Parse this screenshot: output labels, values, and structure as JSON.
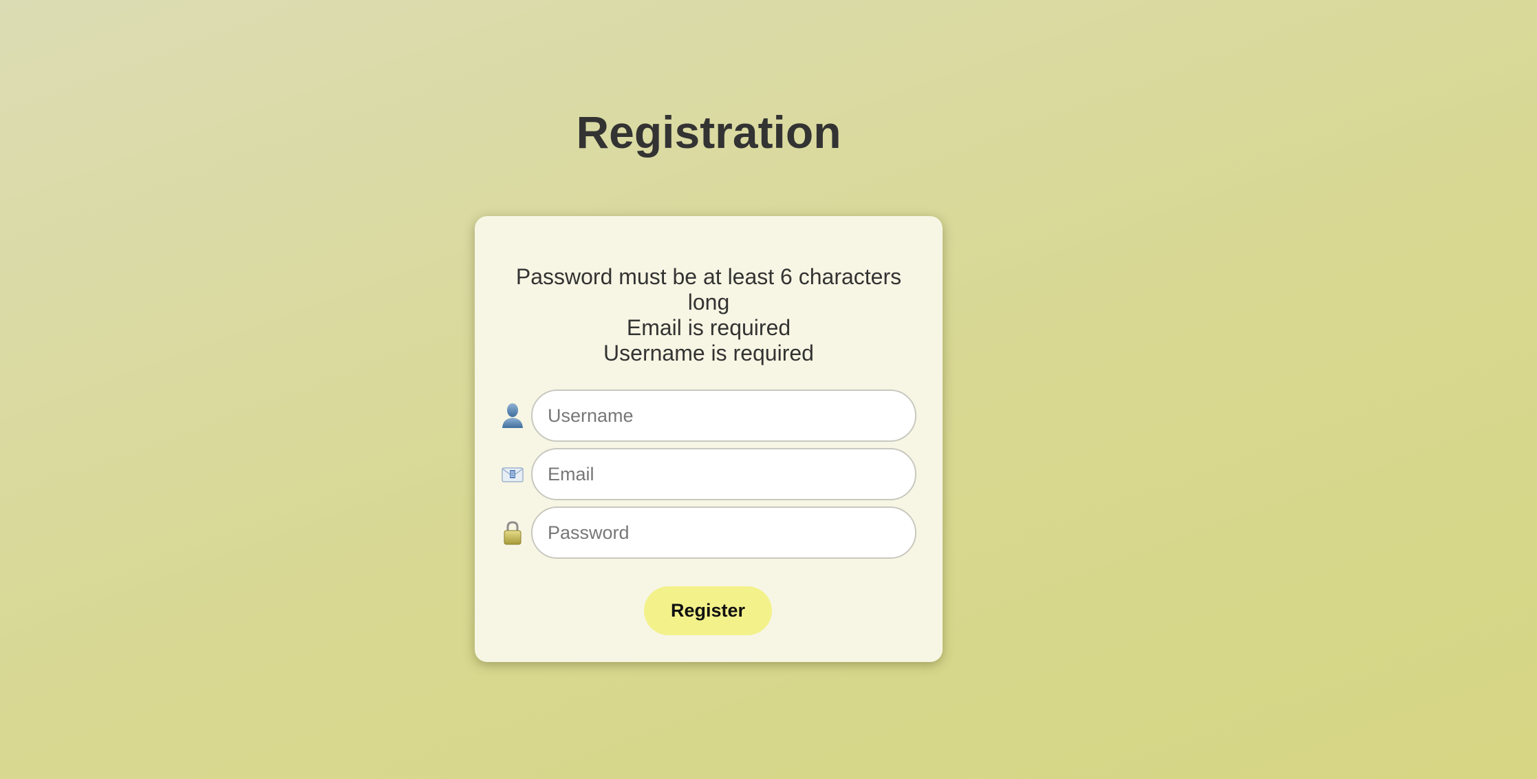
{
  "page": {
    "title": "Registration"
  },
  "errors": [
    "Password must be at least 6 characters long",
    "Email is required",
    "Username is required"
  ],
  "form": {
    "username": {
      "value": "",
      "placeholder": "Username",
      "icon": "user-icon"
    },
    "email": {
      "value": "",
      "placeholder": "Email",
      "icon": "envelope-icon"
    },
    "password": {
      "value": "",
      "placeholder": "Password",
      "icon": "lock-icon"
    },
    "submit_label": "Register"
  },
  "colors": {
    "background": "#d8d892",
    "card": "#f7f6e4",
    "button": "#f3f18a",
    "text": "#333333"
  }
}
